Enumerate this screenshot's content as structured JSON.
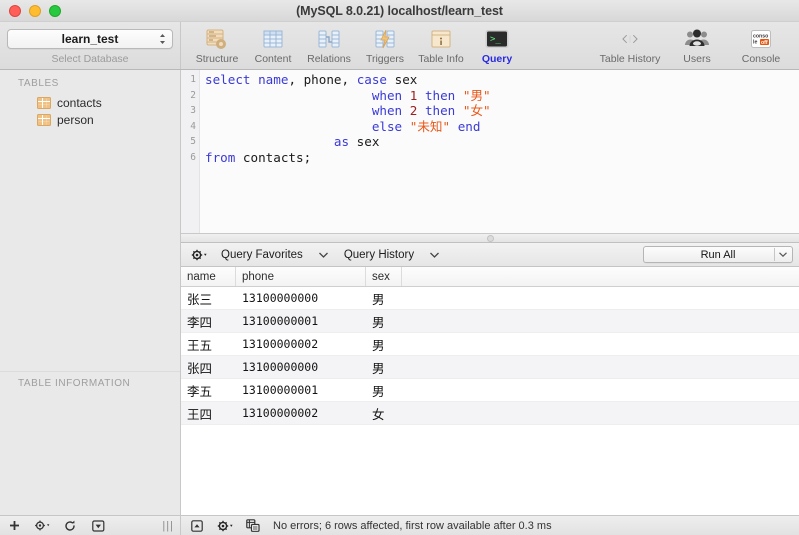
{
  "window": {
    "title": "(MySQL 8.0.21) localhost/learn_test"
  },
  "toolbar": {
    "database_select": {
      "value": "learn_test",
      "caption": "Select Database"
    },
    "tabs": [
      {
        "label": "Structure",
        "icon": "structure-icon",
        "active": false
      },
      {
        "label": "Content",
        "icon": "content-icon",
        "active": false
      },
      {
        "label": "Relations",
        "icon": "relations-icon",
        "active": false
      },
      {
        "label": "Triggers",
        "icon": "triggers-icon",
        "active": false
      },
      {
        "label": "Table Info",
        "icon": "table-info-icon",
        "active": false
      },
      {
        "label": "Query",
        "icon": "query-icon",
        "active": true
      }
    ],
    "right_items": [
      {
        "label": "Table History",
        "icon": "history-arrows-icon"
      },
      {
        "label": "Users",
        "icon": "users-icon"
      },
      {
        "label": "Console",
        "icon": "console-icon"
      }
    ]
  },
  "sidebar": {
    "tables_header": "TABLES",
    "tables": [
      {
        "name": "contacts"
      },
      {
        "name": "person"
      }
    ],
    "info_header": "TABLE INFORMATION",
    "footer_buttons": [
      {
        "icon": "plus-icon",
        "glyph": "+"
      },
      {
        "icon": "gear-icon",
        "glyph": "⚙"
      },
      {
        "icon": "refresh-icon",
        "glyph": "⟳"
      },
      {
        "icon": "filter-icon",
        "glyph": "▼"
      }
    ]
  },
  "editor": {
    "line_numbers": [
      "1",
      "2",
      "3",
      "4",
      "5",
      "6"
    ],
    "lines": [
      [
        {
          "t": "select",
          "c": "k"
        },
        {
          "t": " ",
          "c": "id"
        },
        {
          "t": "name",
          "c": "k"
        },
        {
          "t": ", phone, ",
          "c": "id"
        },
        {
          "t": "case",
          "c": "k"
        },
        {
          "t": " sex",
          "c": "id"
        }
      ],
      [
        {
          "t": "                      ",
          "c": "id"
        },
        {
          "t": "when",
          "c": "k"
        },
        {
          "t": " ",
          "c": "id"
        },
        {
          "t": "1",
          "c": "n"
        },
        {
          "t": " ",
          "c": "id"
        },
        {
          "t": "then",
          "c": "k"
        },
        {
          "t": " ",
          "c": "id"
        },
        {
          "t": "\"男\"",
          "c": "s"
        }
      ],
      [
        {
          "t": "                      ",
          "c": "id"
        },
        {
          "t": "when",
          "c": "k"
        },
        {
          "t": " ",
          "c": "id"
        },
        {
          "t": "2",
          "c": "n"
        },
        {
          "t": " ",
          "c": "id"
        },
        {
          "t": "then",
          "c": "k"
        },
        {
          "t": " ",
          "c": "id"
        },
        {
          "t": "\"女\"",
          "c": "s"
        }
      ],
      [
        {
          "t": "                      ",
          "c": "id"
        },
        {
          "t": "else",
          "c": "k"
        },
        {
          "t": " ",
          "c": "id"
        },
        {
          "t": "\"未知\"",
          "c": "s"
        },
        {
          "t": " ",
          "c": "id"
        },
        {
          "t": "end",
          "c": "k"
        }
      ],
      [
        {
          "t": "                 ",
          "c": "id"
        },
        {
          "t": "as",
          "c": "k"
        },
        {
          "t": " sex",
          "c": "id"
        }
      ],
      [
        {
          "t": "from",
          "c": "k"
        },
        {
          "t": " contacts;",
          "c": "id"
        }
      ]
    ],
    "plain_text": "select name, phone, case sex\n                      when 1 then \"男\"\n                      when 2 then \"女\"\n                      else \"未知\" end\n                 as sex\nfrom contacts;"
  },
  "query_bar": {
    "gear_icon": "gear-icon",
    "favorites_label": "Query Favorites",
    "history_label": "Query History",
    "run_all_label": "Run All"
  },
  "results": {
    "columns": [
      "name",
      "phone",
      "sex"
    ],
    "rows": [
      {
        "name": "张三",
        "phone": "13100000000",
        "sex": "男"
      },
      {
        "name": "李四",
        "phone": "13100000001",
        "sex": "男"
      },
      {
        "name": "王五",
        "phone": "13100000002",
        "sex": "男"
      },
      {
        "name": "张四",
        "phone": "13100000000",
        "sex": "男"
      },
      {
        "name": "李五",
        "phone": "13100000001",
        "sex": "男"
      },
      {
        "name": "王四",
        "phone": "13100000002",
        "sex": "女"
      }
    ]
  },
  "status_bar": {
    "buttons": [
      {
        "icon": "panel-toggle-icon",
        "glyph": "▣"
      },
      {
        "icon": "gear-icon",
        "glyph": "⚙"
      },
      {
        "icon": "export-icon",
        "glyph": "⧉"
      }
    ],
    "message": "No errors; 6 rows affected, first row available after 0.3 ms"
  },
  "colors": {
    "keyword": "#3a3ad6",
    "string": "#e8591a",
    "number": "#9b2020",
    "active_tab": "#2a2ae0",
    "table_icon": "#f0c183"
  }
}
